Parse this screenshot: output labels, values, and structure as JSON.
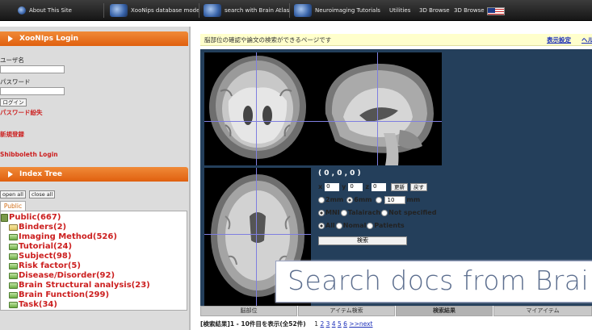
{
  "topnav": {
    "items": [
      "About This Site",
      "XooNips database mode",
      "search with Brain Atlas",
      "Neuroimaging Tutorials",
      "Utilities",
      "3D Browse",
      "3D Browse"
    ]
  },
  "login": {
    "title": "XooNIps Login",
    "username_label": "ユーザ名",
    "password_label": "パスワード",
    "login_button": "ログイン",
    "forgot_password": "パスワード紛失",
    "register": "新規登録",
    "shibboleth": "Shibboleth Login"
  },
  "index_tree": {
    "title": "Index Tree",
    "open_all": "open all",
    "close_all": "close all",
    "tab": "Public",
    "items": [
      "Public(667)",
      "Binders(2)",
      "Imaging Method(526)",
      "Tutorial(24)",
      "Subject(98)",
      "Risk factor(5)",
      "Disease/Disorder(92)",
      "Brain Structural analysis(23)",
      "Brain Function(299)",
      "Task(34)"
    ]
  },
  "main": {
    "description": "脳部位の確認や論文の検索ができるページです",
    "display_settings": "表示設定",
    "help": "ヘルプ"
  },
  "viewer": {
    "coords": "( 0 , 0 , 0 )",
    "x_label": "x",
    "x_value": "0",
    "y_label": "y",
    "y_value": "0",
    "z_label": "z",
    "z_value": "0",
    "update_button": "更新",
    "back_button": "戻す",
    "radius_options": [
      "2mm",
      "6mm"
    ],
    "radius_selected": "6mm",
    "radius_custom": "10",
    "radius_unit": "mm",
    "space_options": [
      "MNI",
      "Talairach",
      "Not specified"
    ],
    "subject_options": [
      "All",
      "Nomal",
      "Patients"
    ],
    "search_button": "検索"
  },
  "tabs": [
    "脳部位",
    "アイテム検索",
    "検索結果",
    "マイアイテム"
  ],
  "results": {
    "summary": "[検索結果]1 - 10件目を表示(全52件)",
    "pages": [
      "1",
      "2",
      "3",
      "4",
      "5",
      "6"
    ],
    "next": ">>next"
  },
  "caption": "Search docs from Brai",
  "colors": {
    "orange_header": "#e8741f",
    "tree_text": "#cc2020",
    "viewer_bg": "#243f5b",
    "crosshair": "#7f7fe0"
  }
}
